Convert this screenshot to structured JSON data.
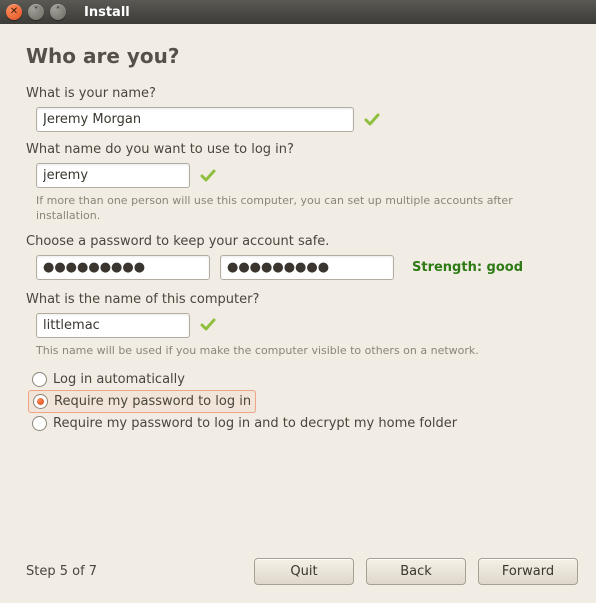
{
  "window": {
    "title": "Install"
  },
  "page": {
    "heading": "Who are you?",
    "name_label": "What is your name?",
    "name_value": "Jeremy Morgan",
    "username_label": "What name do you want to use to log in?",
    "username_value": "jeremy",
    "username_hint": "If more than one person will use this computer, you can set up multiple accounts after installation.",
    "password_label": "Choose a password to keep your account safe.",
    "password1_value": "●●●●●●●●●",
    "password2_value": "●●●●●●●●●",
    "strength_label": "Strength: good",
    "computer_label": "What is the name of this computer?",
    "computer_value": "littlemac",
    "computer_hint": "This name will be used if you make the computer visible to others on a network.",
    "login_options": {
      "auto": "Log in automatically",
      "require": "Require my password to log in",
      "encrypt": "Require my password to log in and to decrypt my home folder",
      "selected": "require"
    }
  },
  "footer": {
    "step": "Step 5 of 7",
    "quit": "Quit",
    "back": "Back",
    "forward": "Forward"
  }
}
